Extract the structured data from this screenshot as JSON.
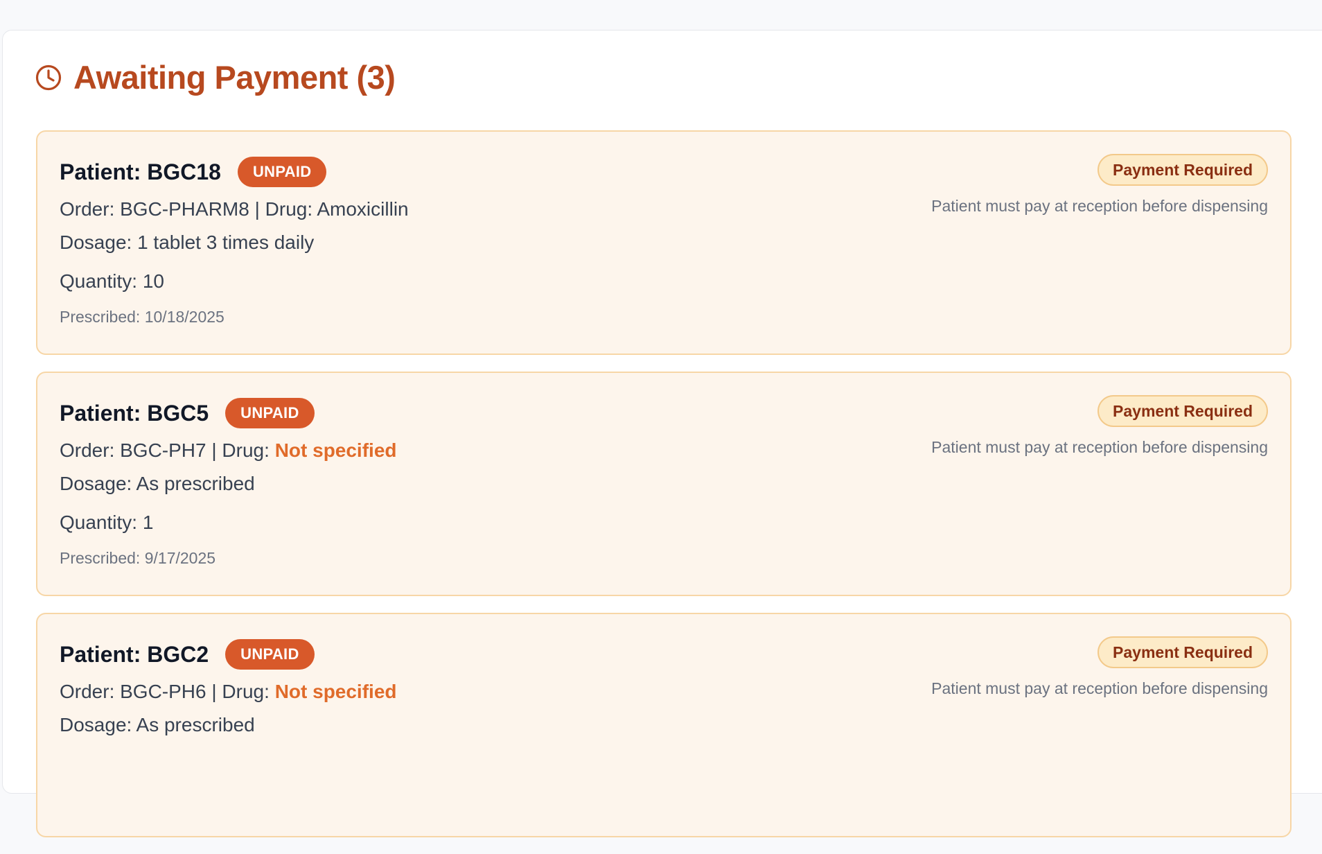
{
  "section": {
    "title": "Awaiting Payment (3)",
    "icon": "clock-icon",
    "accent_color": "#b7491f"
  },
  "orders": [
    {
      "patient": "Patient: BGC18",
      "status": "UNPAID",
      "order_prefix": "Order: BGC-PHARM8 | Drug: ",
      "drug": "Amoxicillin",
      "drug_specified": true,
      "dosage": "Dosage: 1 tablet 3 times daily",
      "quantity": "Quantity: 10",
      "prescribed": "Prescribed: 10/18/2025",
      "payment_badge": "Payment Required",
      "payment_note": "Patient must pay at reception before dispensing"
    },
    {
      "patient": "Patient: BGC5",
      "status": "UNPAID",
      "order_prefix": "Order: BGC-PH7 | Drug: ",
      "drug": "Not specified",
      "drug_specified": false,
      "dosage": "Dosage: As prescribed",
      "quantity": "Quantity: 1",
      "prescribed": "Prescribed: 9/17/2025",
      "payment_badge": "Payment Required",
      "payment_note": "Patient must pay at reception before dispensing"
    },
    {
      "patient": "Patient: BGC2",
      "status": "UNPAID",
      "order_prefix": "Order: BGC-PH6 | Drug: ",
      "drug": "Not specified",
      "drug_specified": false,
      "dosage": "Dosage: As prescribed",
      "quantity": "",
      "prescribed": "",
      "payment_badge": "Payment Required",
      "payment_note": "Patient must pay at reception before dispensing"
    }
  ],
  "colors": {
    "unpaid_badge": "#d8592a",
    "card_background": "#fdf5ec",
    "card_border": "#f7d6a6",
    "drug_missing": "#e06b2a"
  }
}
